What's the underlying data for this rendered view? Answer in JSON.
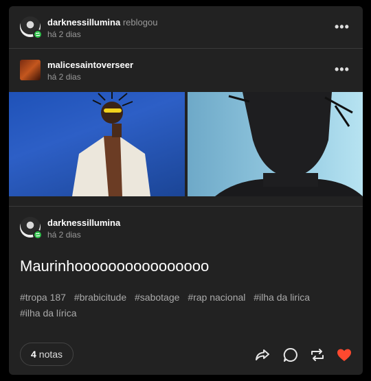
{
  "reblogger": {
    "username": "darknessillumina",
    "action": "reblogou",
    "time": "há 2 dias",
    "menu": "•••"
  },
  "original": {
    "username": "malicesaintoverseer",
    "time": "há 2 dias",
    "menu": "•••"
  },
  "reply": {
    "username": "darknessillumina",
    "time": "há 2 dias",
    "text": "Maurinhoooooooooooooooo",
    "tags": [
      "#tropa 187",
      "#brabicitude",
      "#sabotage",
      "#rap nacional",
      "#ilha da lirica",
      "#ilha da lírica"
    ]
  },
  "footer": {
    "notes_count": "4",
    "notes_label": "notas"
  },
  "colors": {
    "like": "#ff492f",
    "reblog_badge": "#2ec24a"
  },
  "icons": [
    "share-icon",
    "comment-icon",
    "reblog-icon",
    "heart-icon"
  ]
}
